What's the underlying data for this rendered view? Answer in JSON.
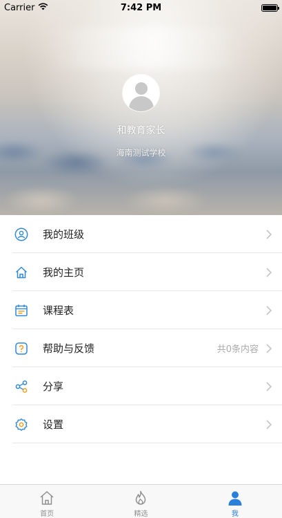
{
  "status_bar": {
    "carrier": "Carrier",
    "time": "7:42 PM"
  },
  "profile": {
    "name": "和教育家长",
    "school": "海南测试学校"
  },
  "menu": {
    "items": [
      {
        "label": "我的班级",
        "icon": "user-circle-icon"
      },
      {
        "label": "我的主页",
        "icon": "home-icon"
      },
      {
        "label": "课程表",
        "icon": "calendar-icon"
      },
      {
        "label": "帮助与反馈",
        "icon": "question-icon",
        "extra": "共0条内容"
      },
      {
        "label": "分享",
        "icon": "share-icon"
      },
      {
        "label": "设置",
        "icon": "gear-icon"
      }
    ]
  },
  "tab_bar": {
    "tabs": [
      {
        "label": "首页",
        "icon": "home-icon"
      },
      {
        "label": "精选",
        "icon": "flame-icon"
      },
      {
        "label": "我",
        "icon": "person-icon",
        "active": true
      }
    ]
  },
  "colors": {
    "accent": "#2a7fd8",
    "icon_blue": "#2f87d6",
    "icon_orange": "#f0a020"
  }
}
